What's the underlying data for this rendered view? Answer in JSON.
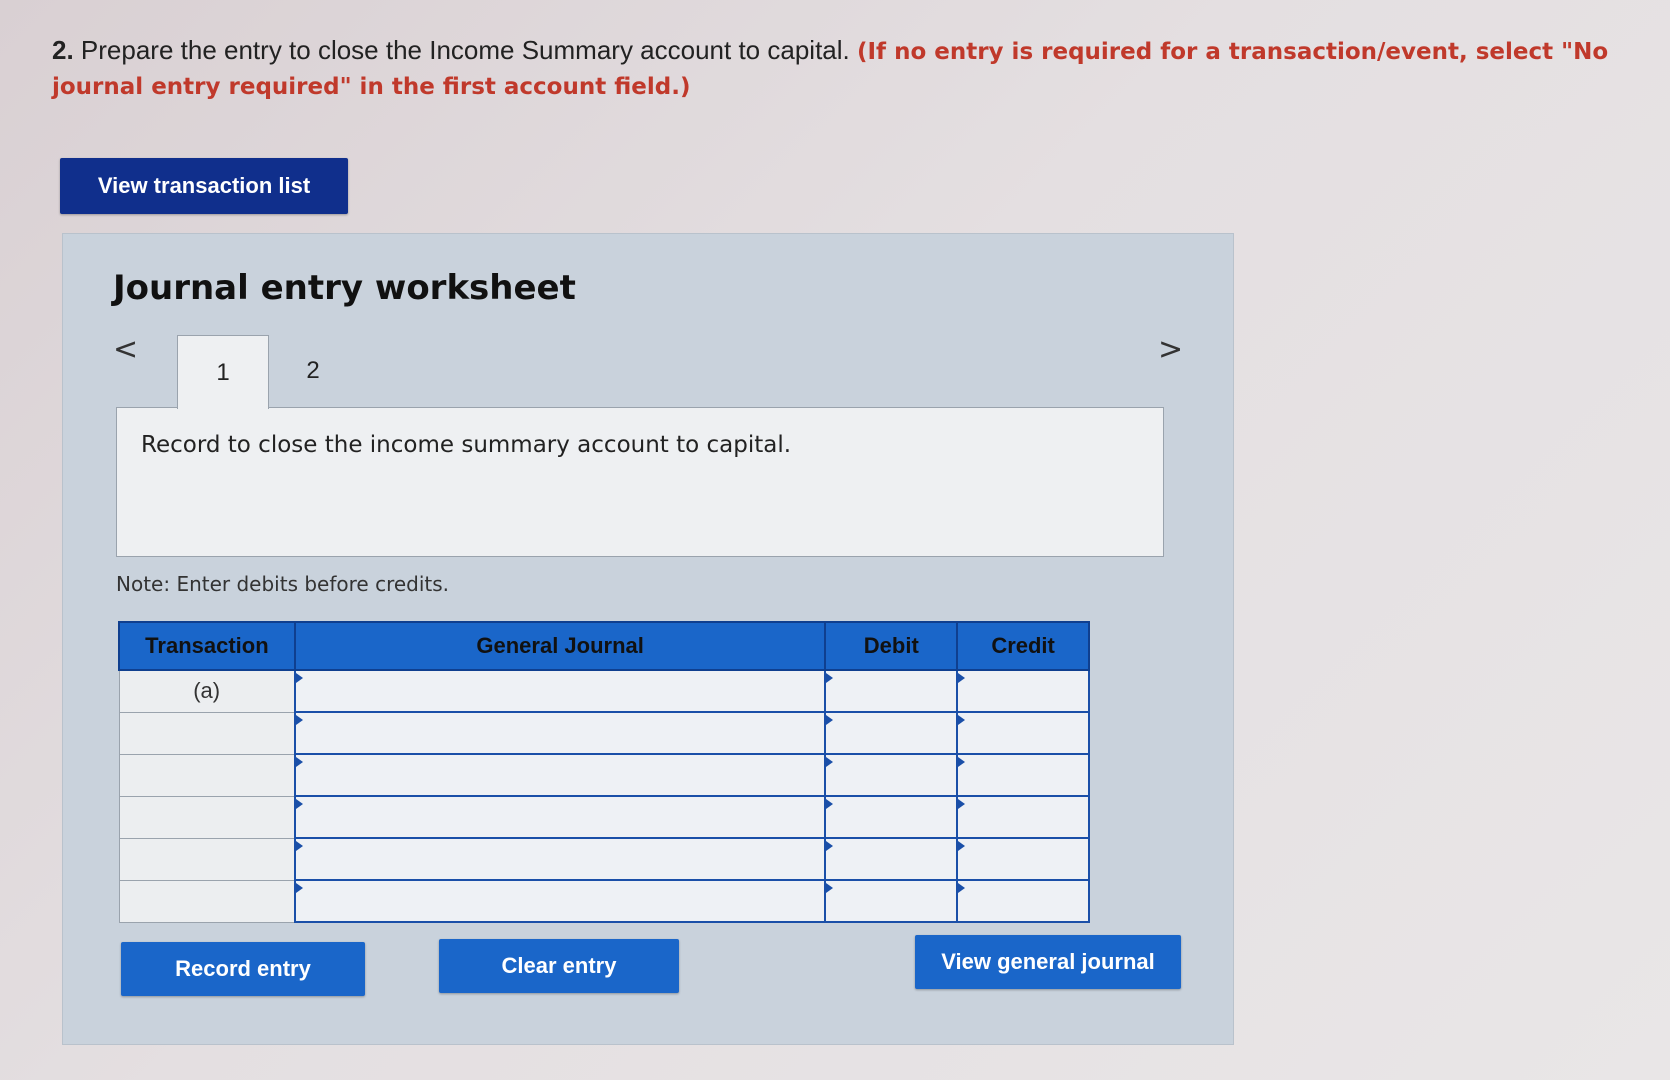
{
  "question": {
    "number": "2.",
    "text": "Prepare the entry to close the Income Summary account to capital.",
    "instruction": "(If no entry is required for a transaction/event, select \"No journal entry required\" in the first account field.)"
  },
  "buttons": {
    "view_transaction_list": "View transaction list",
    "record_entry": "Record entry",
    "clear_entry": "Clear entry",
    "view_general_journal": "View general journal"
  },
  "worksheet": {
    "title": "Journal entry worksheet",
    "tabs": [
      "1",
      "2"
    ],
    "active_tab": "1",
    "record_text": "Record to close the income summary account to capital.",
    "note": "Note: Enter debits before credits.",
    "nav_prev": "<",
    "nav_next": ">"
  },
  "journal_table": {
    "headers": [
      "Transaction",
      "General Journal",
      "Debit",
      "Credit"
    ],
    "rows": [
      {
        "transaction": "(a)",
        "account": "",
        "debit": "",
        "credit": ""
      },
      {
        "transaction": "",
        "account": "",
        "debit": "",
        "credit": ""
      },
      {
        "transaction": "",
        "account": "",
        "debit": "",
        "credit": ""
      },
      {
        "transaction": "",
        "account": "",
        "debit": "",
        "credit": ""
      },
      {
        "transaction": "",
        "account": "",
        "debit": "",
        "credit": ""
      },
      {
        "transaction": "",
        "account": "",
        "debit": "",
        "credit": ""
      }
    ]
  }
}
